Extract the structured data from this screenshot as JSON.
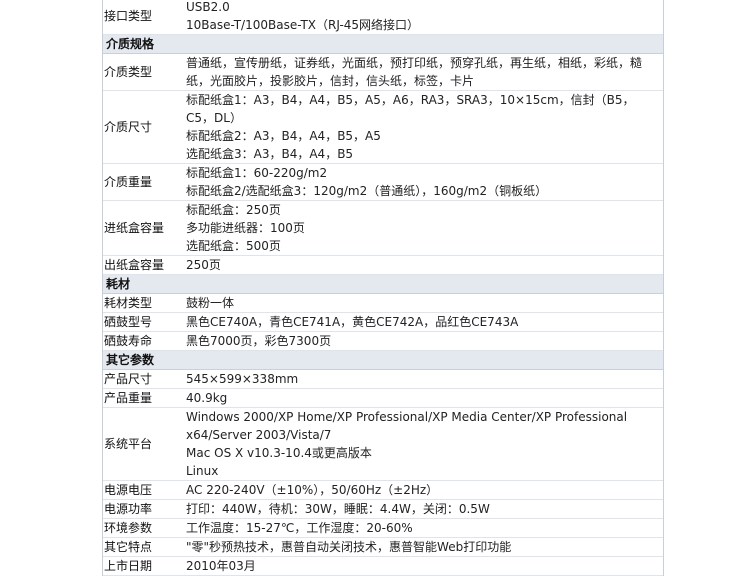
{
  "sections": [
    {
      "title": "",
      "rows": [
        {
          "label": "接口类型",
          "values": [
            "USB2.0",
            "10Base-T/100Base-TX（RJ-45网络接口）"
          ]
        }
      ]
    },
    {
      "title": "介质规格",
      "rows": [
        {
          "label": "介质类型",
          "values": [
            "普通纸，宣传册纸，证券纸，光面纸，预打印纸，预穿孔纸，再生纸，相纸，彩纸，糙纸，光面胶片，投影胶片，信封，信头纸，标签，卡片"
          ]
        },
        {
          "label": "介质尺寸",
          "values": [
            "标配纸盒1：A3，B4，A4，B5，A5，A6，RA3，SRA3，10×15cm，信封（B5，C5，DL）",
            "标配纸盒2：A3，B4，A4，B5，A5",
            "选配纸盒3：A3，B4，A4，B5"
          ]
        },
        {
          "label": "介质重量",
          "values": [
            "标配纸盒1：60-220g/m2",
            "标配纸盒2/选配纸盒3：120g/m2（普通纸），160g/m2（铜板纸）"
          ]
        },
        {
          "label": "进纸盒容量",
          "values": [
            "标配纸盒：250页",
            "多功能进纸器：100页",
            "选配纸盒：500页"
          ]
        },
        {
          "label": "出纸盒容量",
          "values": [
            "250页"
          ]
        }
      ]
    },
    {
      "title": "耗材",
      "rows": [
        {
          "label": "耗材类型",
          "values": [
            "鼓粉一体"
          ]
        },
        {
          "label": "硒鼓型号",
          "values": [
            "黑色CE740A，青色CE741A，黄色CE742A，品红色CE743A"
          ]
        },
        {
          "label": "硒鼓寿命",
          "values": [
            "黑色7000页，彩色7300页"
          ]
        }
      ]
    },
    {
      "title": "其它参数",
      "rows": [
        {
          "label": "产品尺寸",
          "values": [
            "545×599×338mm"
          ]
        },
        {
          "label": "产品重量",
          "values": [
            "40.9kg"
          ]
        },
        {
          "label": "系统平台",
          "values": [
            "Windows 2000/XP Home/XP Professional/XP Media Center/XP Professional x64/Server 2003/Vista/7",
            "Mac OS X v10.3-10.4或更高版本",
            "Linux"
          ]
        },
        {
          "label": "电源电压",
          "values": [
            "AC 220-240V（±10%），50/60Hz（±2Hz）"
          ]
        },
        {
          "label": "电源功率",
          "values": [
            "打印：440W，待机：30W，睡眠：4.4W，关闭：0.5W"
          ]
        },
        {
          "label": "环境参数",
          "values": [
            "工作温度：15-27℃，工作湿度：20-60%"
          ]
        },
        {
          "label": "其它特点",
          "values": [
            "\"零\"秒预热技术，惠普自动关闭技术，惠普智能Web打印功能"
          ]
        },
        {
          "label": "上市日期",
          "values": [
            "2010年03月"
          ]
        }
      ]
    }
  ]
}
